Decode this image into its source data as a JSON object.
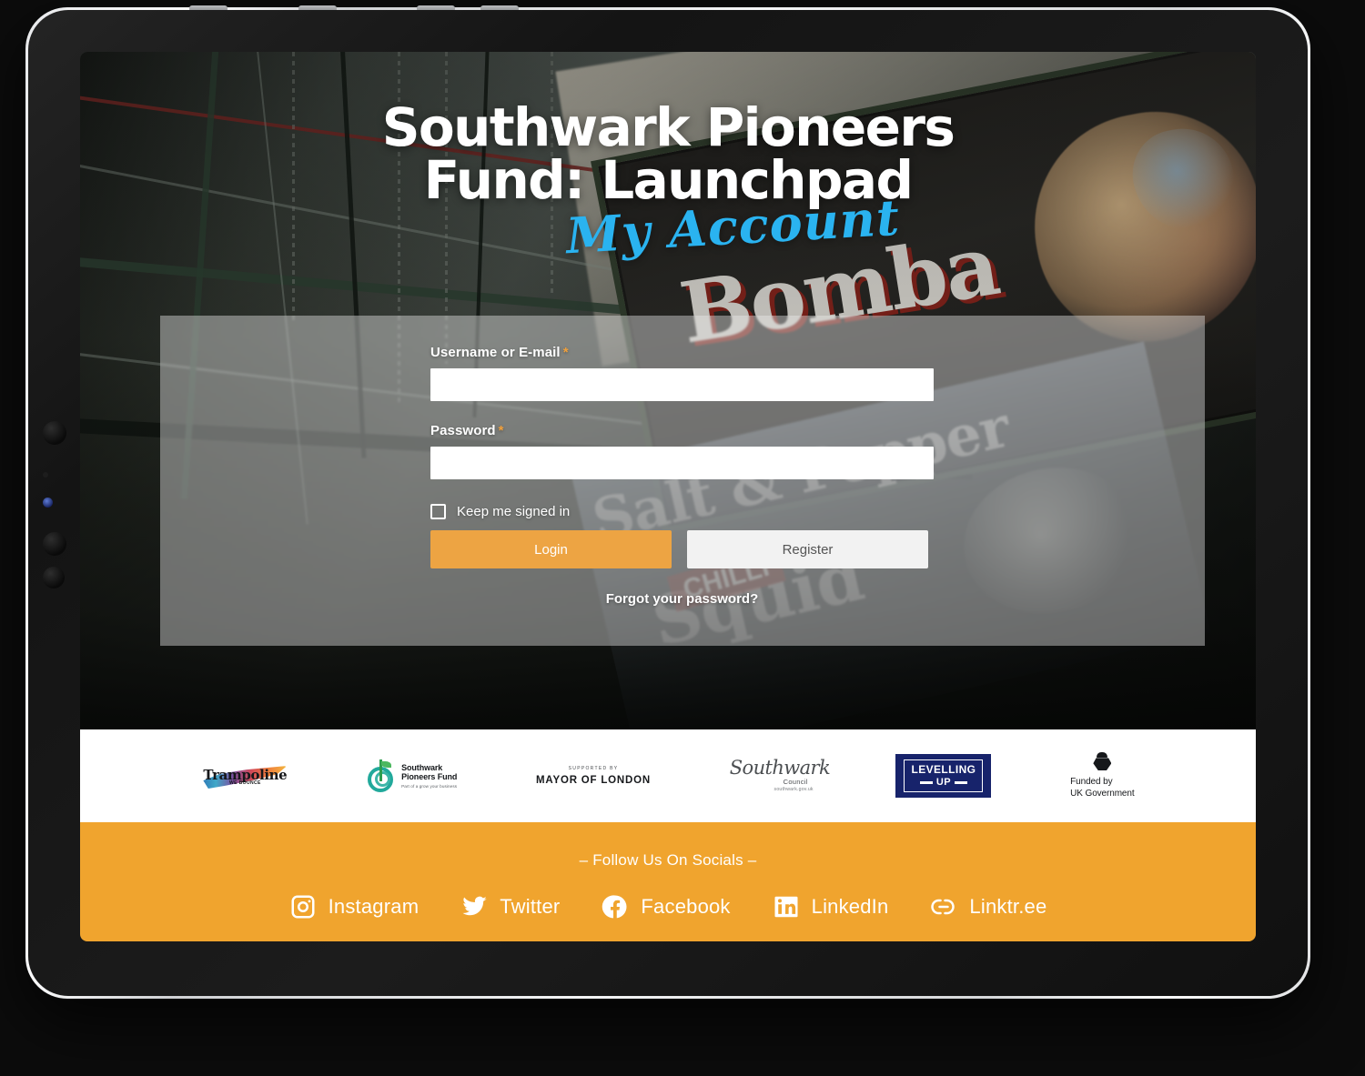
{
  "device": {
    "type": "tablet",
    "orientation": "landscape"
  },
  "hero": {
    "title_line1": "Southwark Pioneers",
    "title_line2": "Fund: Launchpad",
    "subtitle": "My Account",
    "subtitle_color": "#2ab3f0",
    "background_description": "Market hall interior with Bomba and Salt & Pepper Chilli Squid signage"
  },
  "login": {
    "username": {
      "label": "Username or E-mail",
      "required_marker": "*",
      "value": "",
      "placeholder": ""
    },
    "password": {
      "label": "Password",
      "required_marker": "*",
      "value": "",
      "placeholder": ""
    },
    "keep_signed_in": {
      "label": "Keep me signed in",
      "checked": false
    },
    "login_button": "Login",
    "register_button": "Register",
    "forgot_link": "Forgot your password?",
    "accent_color": "#eda443",
    "secondary_button_color": "#f2f2f2"
  },
  "partners": [
    {
      "name": "Trampoline",
      "word": "Trampoline",
      "sub": "WE BOUNCE"
    },
    {
      "name": "Southwark Pioneers Fund",
      "line1": "Southwark",
      "line2": "Pioneers Fund",
      "line3": "Part of a grow your business"
    },
    {
      "name": "Mayor of London",
      "small": "SUPPORTED BY",
      "big": "MAYOR OF LONDON"
    },
    {
      "name": "Southwark Council",
      "script": "Southwark",
      "word": "Council",
      "url": "southwark.gov.uk"
    },
    {
      "name": "Levelling Up",
      "line1": "LEVELLING",
      "line2": "UP",
      "color": "#17236b"
    },
    {
      "name": "Funded by UK Government",
      "line1": "Funded by",
      "line2": "UK Government"
    }
  ],
  "footer": {
    "heading": "– Follow Us On Socials –",
    "background_color": "#f0a42e",
    "socials": [
      {
        "icon": "instagram-icon",
        "label": "Instagram"
      },
      {
        "icon": "twitter-icon",
        "label": "Twitter"
      },
      {
        "icon": "facebook-icon",
        "label": "Facebook"
      },
      {
        "icon": "linkedin-icon",
        "label": "LinkedIn"
      },
      {
        "icon": "linktree-icon",
        "label": "Linktr.ee"
      }
    ]
  },
  "background_signage": {
    "sign1": "Bomba",
    "sign2_line1": "Salt & Pepper",
    "sign2_line2": "Squid",
    "sign2_badge": "CHILLI"
  }
}
